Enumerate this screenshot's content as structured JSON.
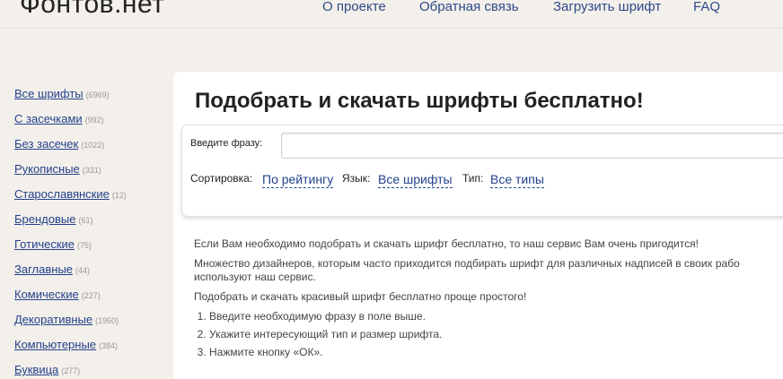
{
  "header": {
    "logo": "Фонтов.нет",
    "nav": [
      {
        "label": "О проекте"
      },
      {
        "label": "Обратная связь"
      },
      {
        "label": "Загрузить шрифт"
      },
      {
        "label": "FAQ"
      }
    ]
  },
  "sidebar": {
    "categories": [
      {
        "label": "Все шрифты",
        "count": "(6969)"
      },
      {
        "label": "С засечками",
        "count": "(992)"
      },
      {
        "label": "Без засечек",
        "count": "(1022)"
      },
      {
        "label": "Рукописные",
        "count": "(331)"
      },
      {
        "label": "Старославянские",
        "count": "(12)"
      },
      {
        "label": "Брендовые",
        "count": "(61)"
      },
      {
        "label": "Готические",
        "count": "(75)"
      },
      {
        "label": "Заглавные",
        "count": "(44)"
      },
      {
        "label": "Комические",
        "count": "(227)"
      },
      {
        "label": "Декоративные",
        "count": "(1950)"
      },
      {
        "label": "Компьютерные",
        "count": "(384)"
      },
      {
        "label": "Буквица",
        "count": "(277)"
      }
    ]
  },
  "main": {
    "title": "Подобрать и скачать шрифты бесплатно!",
    "search": {
      "phrase_label": "Введите фразу:",
      "phrase_value": "",
      "sort_label": "Сортировка:",
      "sort_value": "По рейтингу",
      "lang_label": "Язык:",
      "lang_value": "Все шрифты",
      "type_label": "Тип:",
      "type_value": "Все типы"
    },
    "paragraphs": [
      "Если Вам необходимо подобрать и скачать шрифт бесплатно, то наш сервис Вам очень пригодится!",
      "Множество дизайнеров, которым часто приходится подбирать шрифт для различных надписей в своих рабо",
      "используют наш сервис.",
      "Подобрать и скачать красивый шрифт бесплатно проще простого!"
    ],
    "steps": [
      "Введите необходимую фразу в поле выше.",
      "Укажите интересующий тип и размер шрифта.",
      "Нажмите кнопку «ОК»."
    ]
  }
}
